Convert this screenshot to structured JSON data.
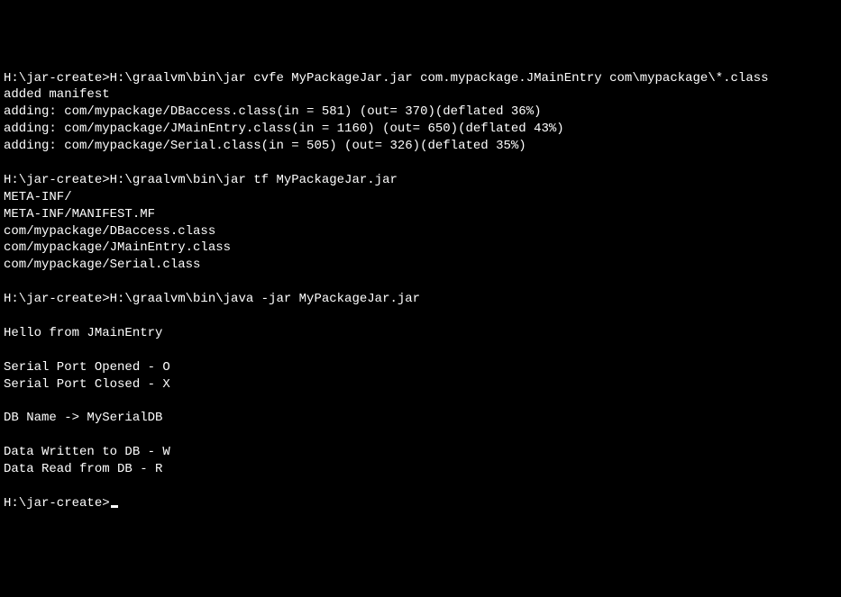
{
  "terminal": {
    "lines": [
      "H:\\jar-create>H:\\graalvm\\bin\\jar cvfe MyPackageJar.jar com.mypackage.JMainEntry com\\mypackage\\*.class",
      "added manifest",
      "adding: com/mypackage/DBaccess.class(in = 581) (out= 370)(deflated 36%)",
      "adding: com/mypackage/JMainEntry.class(in = 1160) (out= 650)(deflated 43%)",
      "adding: com/mypackage/Serial.class(in = 505) (out= 326)(deflated 35%)",
      "",
      "H:\\jar-create>H:\\graalvm\\bin\\jar tf MyPackageJar.jar",
      "META-INF/",
      "META-INF/MANIFEST.MF",
      "com/mypackage/DBaccess.class",
      "com/mypackage/JMainEntry.class",
      "com/mypackage/Serial.class",
      "",
      "H:\\jar-create>H:\\graalvm\\bin\\java -jar MyPackageJar.jar",
      "",
      "Hello from JMainEntry",
      "",
      "Serial Port Opened - O",
      "Serial Port Closed - X",
      "",
      "DB Name -> MySerialDB",
      "",
      "Data Written to DB - W",
      "Data Read from DB - R",
      "",
      "H:\\jar-create>"
    ]
  }
}
